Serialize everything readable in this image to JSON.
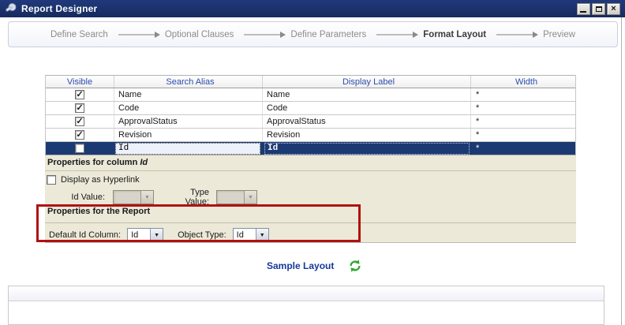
{
  "window": {
    "title": "Report Designer",
    "close_glyph": "×"
  },
  "wizard": {
    "steps": [
      {
        "label": "Define Search",
        "active": false
      },
      {
        "label": "Optional Clauses",
        "active": false
      },
      {
        "label": "Define Parameters",
        "active": false
      },
      {
        "label": "Format Layout",
        "active": true
      },
      {
        "label": "Preview",
        "active": false
      }
    ]
  },
  "grid": {
    "headers": [
      "Visible",
      "Search Alias",
      "Display Label",
      "Width"
    ],
    "rows": [
      {
        "visible": true,
        "search_alias": "Name",
        "display_label": "Name",
        "width": "*",
        "selected": false
      },
      {
        "visible": true,
        "search_alias": "Code",
        "display_label": "Code",
        "width": "*",
        "selected": false
      },
      {
        "visible": true,
        "search_alias": "ApprovalStatus",
        "display_label": "ApprovalStatus",
        "width": "*",
        "selected": false
      },
      {
        "visible": true,
        "search_alias": "Revision",
        "display_label": "Revision",
        "width": "*",
        "selected": false
      },
      {
        "visible": false,
        "search_alias": "Id",
        "display_label": "Id",
        "width": "*",
        "selected": true
      }
    ]
  },
  "column_properties": {
    "title_prefix": "Properties for column",
    "column_name": "Id",
    "hyperlink_label": "Display as Hyperlink",
    "hyperlink_checked": false,
    "id_value_label": "Id Value:",
    "id_value": "",
    "type_value_label": "Type Value:",
    "type_value": ""
  },
  "report_properties": {
    "title": "Properties for the Report",
    "default_id_column_label": "Default Id Column:",
    "default_id_column_value": "Id",
    "object_type_label": "Object Type:",
    "object_type_value": "Id"
  },
  "sample": {
    "label": "Sample Layout"
  },
  "colors": {
    "titlebar": "#1b3069",
    "selection_row": "#1b3a73",
    "grid_header_text": "#2b4bad",
    "section_background": "#ece9d8",
    "highlight_rectangle": "#b01111",
    "refresh_green": "#2fa832",
    "accent_blue": "#16389b"
  }
}
